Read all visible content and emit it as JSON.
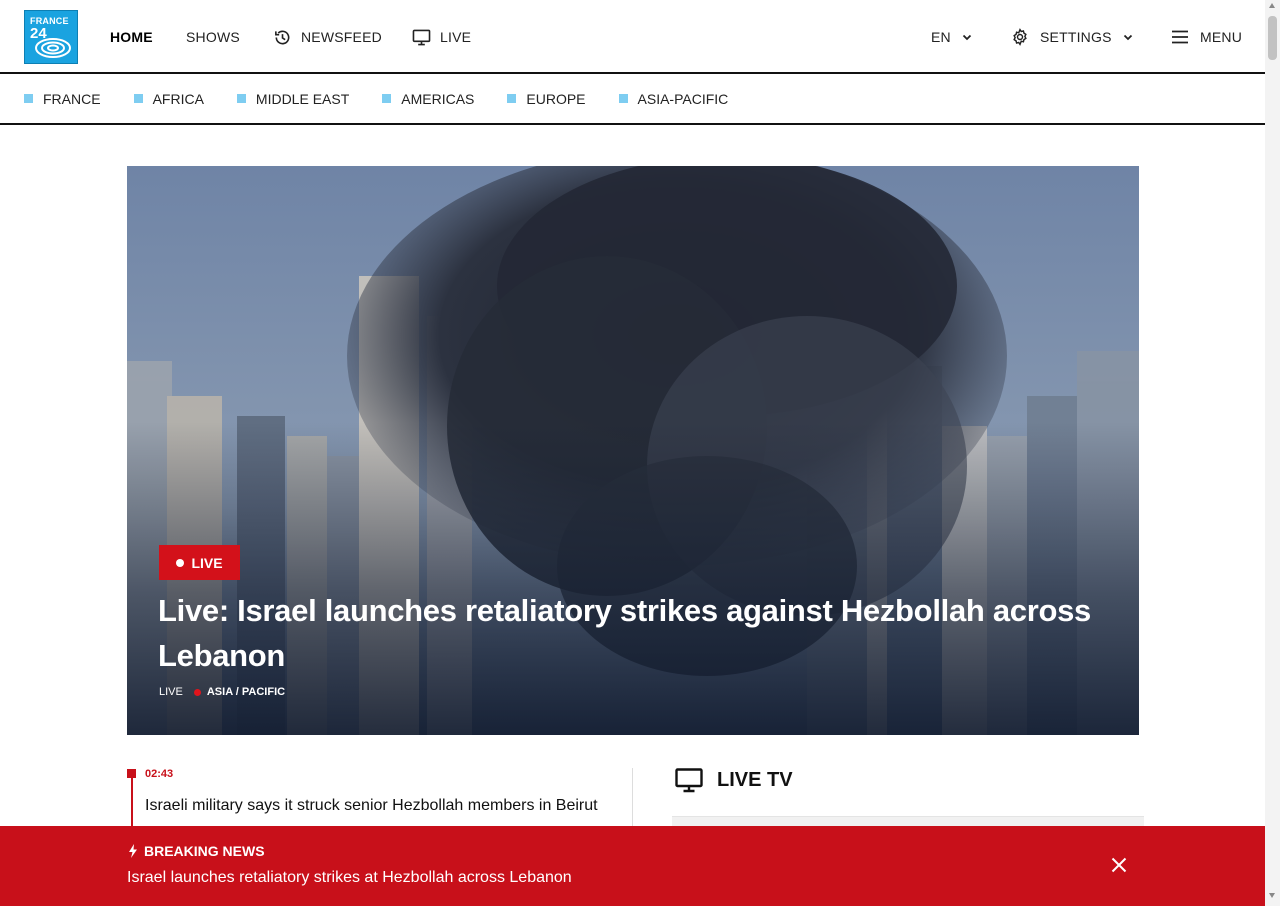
{
  "header": {
    "logo_line1": "FRANCE",
    "logo_line2": "24",
    "nav": {
      "home": "HOME",
      "shows": "SHOWS",
      "newsfeed": "NEWSFEED",
      "live": "LIVE"
    },
    "language": "EN",
    "settings": "SETTINGS",
    "menu": "MENU"
  },
  "sections": [
    "FRANCE",
    "AFRICA",
    "MIDDLE EAST",
    "AMERICAS",
    "EUROPE",
    "ASIA-PACIFIC"
  ],
  "hero": {
    "badge": "LIVE",
    "title": "Live: Israel launches retaliatory strikes against Hezbollah across Lebanon",
    "meta_type": "LIVE",
    "meta_category": "ASIA / PACIFIC"
  },
  "feed": {
    "time": "02:43",
    "text": "Israeli military says it struck senior Hezbollah members in Beirut"
  },
  "live_tv": {
    "title": "LIVE TV"
  },
  "breaking": {
    "label": "BREAKING NEWS",
    "text": "Israel launches retaliatory strikes at Hezbollah across Lebanon"
  },
  "colors": {
    "accent_red": "#c8101a",
    "section_square": "#7ecdf1",
    "logo_blue": "#1aa3e0"
  }
}
